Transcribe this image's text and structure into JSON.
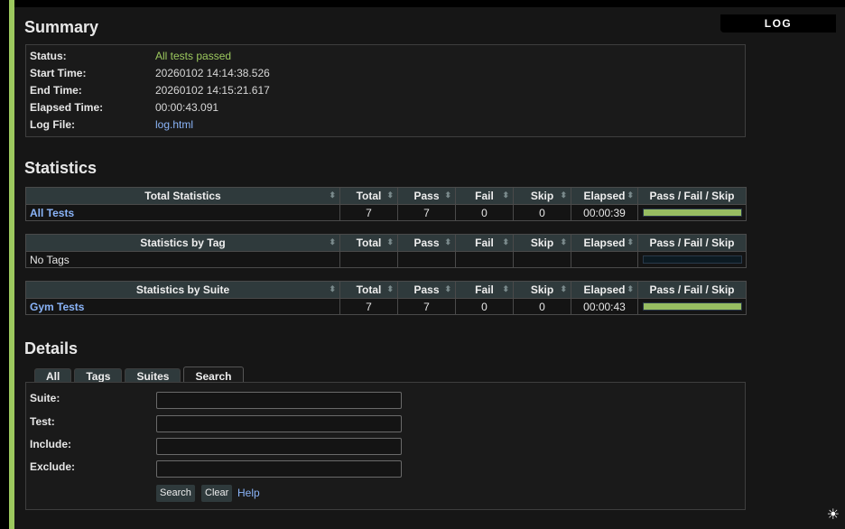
{
  "log_link": "LOG",
  "summary": {
    "heading": "Summary",
    "rows": [
      {
        "key": "Status:",
        "value": "All tests passed"
      },
      {
        "key": "Start Time:",
        "value": "20260102 14:14:38.526"
      },
      {
        "key": "End Time:",
        "value": "20260102 14:15:21.617"
      },
      {
        "key": "Elapsed Time:",
        "value": "00:00:43.091"
      },
      {
        "key": "Log File:",
        "value": "log.html"
      }
    ]
  },
  "statistics": {
    "heading": "Statistics",
    "columns": [
      "Total",
      "Pass",
      "Fail",
      "Skip",
      "Elapsed",
      "Pass / Fail / Skip"
    ],
    "total": {
      "header": "Total Statistics",
      "row": {
        "name": "All Tests",
        "total": "7",
        "pass": "7",
        "fail": "0",
        "skip": "0",
        "elapsed": "00:00:39",
        "pass_ratio": 1.0
      }
    },
    "tag": {
      "header": "Statistics by Tag",
      "row": {
        "name": "No Tags",
        "pass_ratio": 0
      }
    },
    "suite": {
      "header": "Statistics by Suite",
      "row": {
        "name": "Gym Tests",
        "total": "7",
        "pass": "7",
        "fail": "0",
        "skip": "0",
        "elapsed": "00:00:43",
        "pass_ratio": 1.0
      }
    }
  },
  "details": {
    "heading": "Details",
    "tabs": [
      "All",
      "Tags",
      "Suites",
      "Search"
    ],
    "active_tab": "Search",
    "fields": [
      {
        "label": "Suite:",
        "value": ""
      },
      {
        "label": "Test:",
        "value": ""
      },
      {
        "label": "Include:",
        "value": ""
      },
      {
        "label": "Exclude:",
        "value": ""
      }
    ],
    "search_button": "Search",
    "clear_button": "Clear",
    "help_link": "Help"
  },
  "colors": {
    "pass": "#9cc85e",
    "link": "#8ab4f8",
    "header_bg": "#2f3a3c"
  },
  "icons": {
    "sort": "sort-arrows-icon",
    "theme": "sun-icon"
  }
}
